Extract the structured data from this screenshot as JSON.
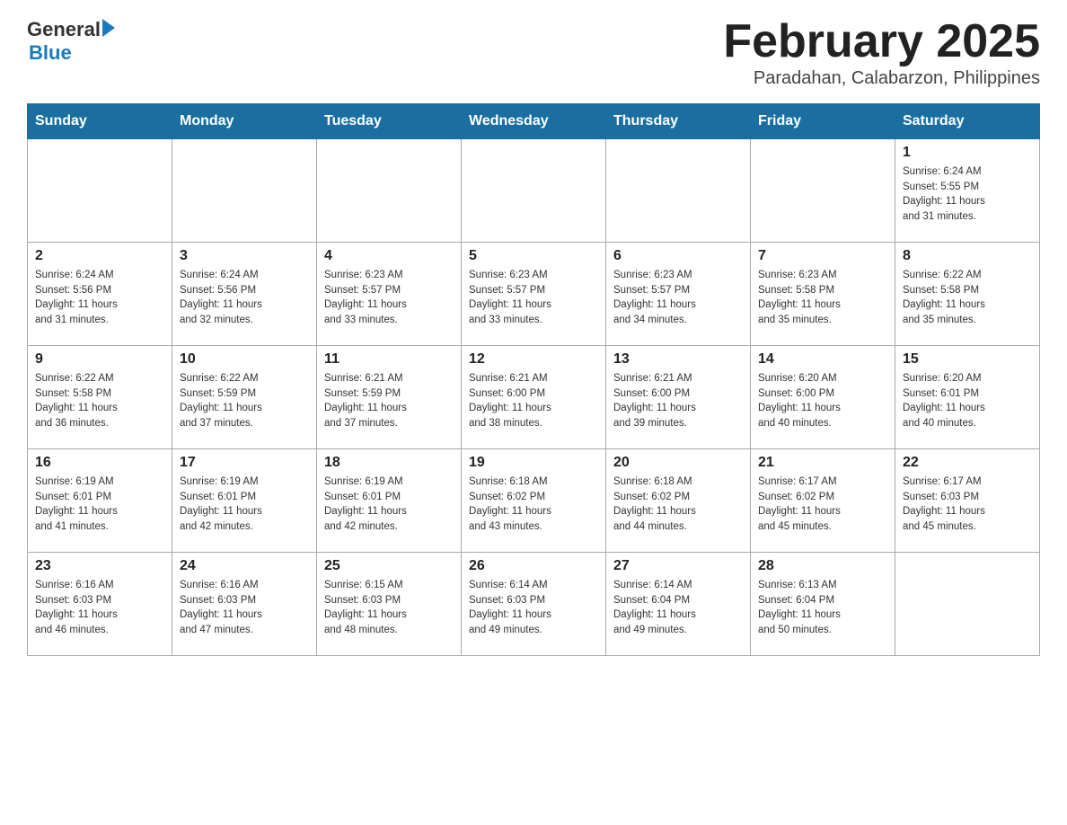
{
  "header": {
    "logo_general": "General",
    "logo_blue": "Blue",
    "month_title": "February 2025",
    "location": "Paradahan, Calabarzon, Philippines"
  },
  "weekdays": [
    "Sunday",
    "Monday",
    "Tuesday",
    "Wednesday",
    "Thursday",
    "Friday",
    "Saturday"
  ],
  "weeks": [
    [
      {
        "day": "",
        "info": ""
      },
      {
        "day": "",
        "info": ""
      },
      {
        "day": "",
        "info": ""
      },
      {
        "day": "",
        "info": ""
      },
      {
        "day": "",
        "info": ""
      },
      {
        "day": "",
        "info": ""
      },
      {
        "day": "1",
        "info": "Sunrise: 6:24 AM\nSunset: 5:55 PM\nDaylight: 11 hours\nand 31 minutes."
      }
    ],
    [
      {
        "day": "2",
        "info": "Sunrise: 6:24 AM\nSunset: 5:56 PM\nDaylight: 11 hours\nand 31 minutes."
      },
      {
        "day": "3",
        "info": "Sunrise: 6:24 AM\nSunset: 5:56 PM\nDaylight: 11 hours\nand 32 minutes."
      },
      {
        "day": "4",
        "info": "Sunrise: 6:23 AM\nSunset: 5:57 PM\nDaylight: 11 hours\nand 33 minutes."
      },
      {
        "day": "5",
        "info": "Sunrise: 6:23 AM\nSunset: 5:57 PM\nDaylight: 11 hours\nand 33 minutes."
      },
      {
        "day": "6",
        "info": "Sunrise: 6:23 AM\nSunset: 5:57 PM\nDaylight: 11 hours\nand 34 minutes."
      },
      {
        "day": "7",
        "info": "Sunrise: 6:23 AM\nSunset: 5:58 PM\nDaylight: 11 hours\nand 35 minutes."
      },
      {
        "day": "8",
        "info": "Sunrise: 6:22 AM\nSunset: 5:58 PM\nDaylight: 11 hours\nand 35 minutes."
      }
    ],
    [
      {
        "day": "9",
        "info": "Sunrise: 6:22 AM\nSunset: 5:58 PM\nDaylight: 11 hours\nand 36 minutes."
      },
      {
        "day": "10",
        "info": "Sunrise: 6:22 AM\nSunset: 5:59 PM\nDaylight: 11 hours\nand 37 minutes."
      },
      {
        "day": "11",
        "info": "Sunrise: 6:21 AM\nSunset: 5:59 PM\nDaylight: 11 hours\nand 37 minutes."
      },
      {
        "day": "12",
        "info": "Sunrise: 6:21 AM\nSunset: 6:00 PM\nDaylight: 11 hours\nand 38 minutes."
      },
      {
        "day": "13",
        "info": "Sunrise: 6:21 AM\nSunset: 6:00 PM\nDaylight: 11 hours\nand 39 minutes."
      },
      {
        "day": "14",
        "info": "Sunrise: 6:20 AM\nSunset: 6:00 PM\nDaylight: 11 hours\nand 40 minutes."
      },
      {
        "day": "15",
        "info": "Sunrise: 6:20 AM\nSunset: 6:01 PM\nDaylight: 11 hours\nand 40 minutes."
      }
    ],
    [
      {
        "day": "16",
        "info": "Sunrise: 6:19 AM\nSunset: 6:01 PM\nDaylight: 11 hours\nand 41 minutes."
      },
      {
        "day": "17",
        "info": "Sunrise: 6:19 AM\nSunset: 6:01 PM\nDaylight: 11 hours\nand 42 minutes."
      },
      {
        "day": "18",
        "info": "Sunrise: 6:19 AM\nSunset: 6:01 PM\nDaylight: 11 hours\nand 42 minutes."
      },
      {
        "day": "19",
        "info": "Sunrise: 6:18 AM\nSunset: 6:02 PM\nDaylight: 11 hours\nand 43 minutes."
      },
      {
        "day": "20",
        "info": "Sunrise: 6:18 AM\nSunset: 6:02 PM\nDaylight: 11 hours\nand 44 minutes."
      },
      {
        "day": "21",
        "info": "Sunrise: 6:17 AM\nSunset: 6:02 PM\nDaylight: 11 hours\nand 45 minutes."
      },
      {
        "day": "22",
        "info": "Sunrise: 6:17 AM\nSunset: 6:03 PM\nDaylight: 11 hours\nand 45 minutes."
      }
    ],
    [
      {
        "day": "23",
        "info": "Sunrise: 6:16 AM\nSunset: 6:03 PM\nDaylight: 11 hours\nand 46 minutes."
      },
      {
        "day": "24",
        "info": "Sunrise: 6:16 AM\nSunset: 6:03 PM\nDaylight: 11 hours\nand 47 minutes."
      },
      {
        "day": "25",
        "info": "Sunrise: 6:15 AM\nSunset: 6:03 PM\nDaylight: 11 hours\nand 48 minutes."
      },
      {
        "day": "26",
        "info": "Sunrise: 6:14 AM\nSunset: 6:03 PM\nDaylight: 11 hours\nand 49 minutes."
      },
      {
        "day": "27",
        "info": "Sunrise: 6:14 AM\nSunset: 6:04 PM\nDaylight: 11 hours\nand 49 minutes."
      },
      {
        "day": "28",
        "info": "Sunrise: 6:13 AM\nSunset: 6:04 PM\nDaylight: 11 hours\nand 50 minutes."
      },
      {
        "day": "",
        "info": ""
      }
    ]
  ]
}
